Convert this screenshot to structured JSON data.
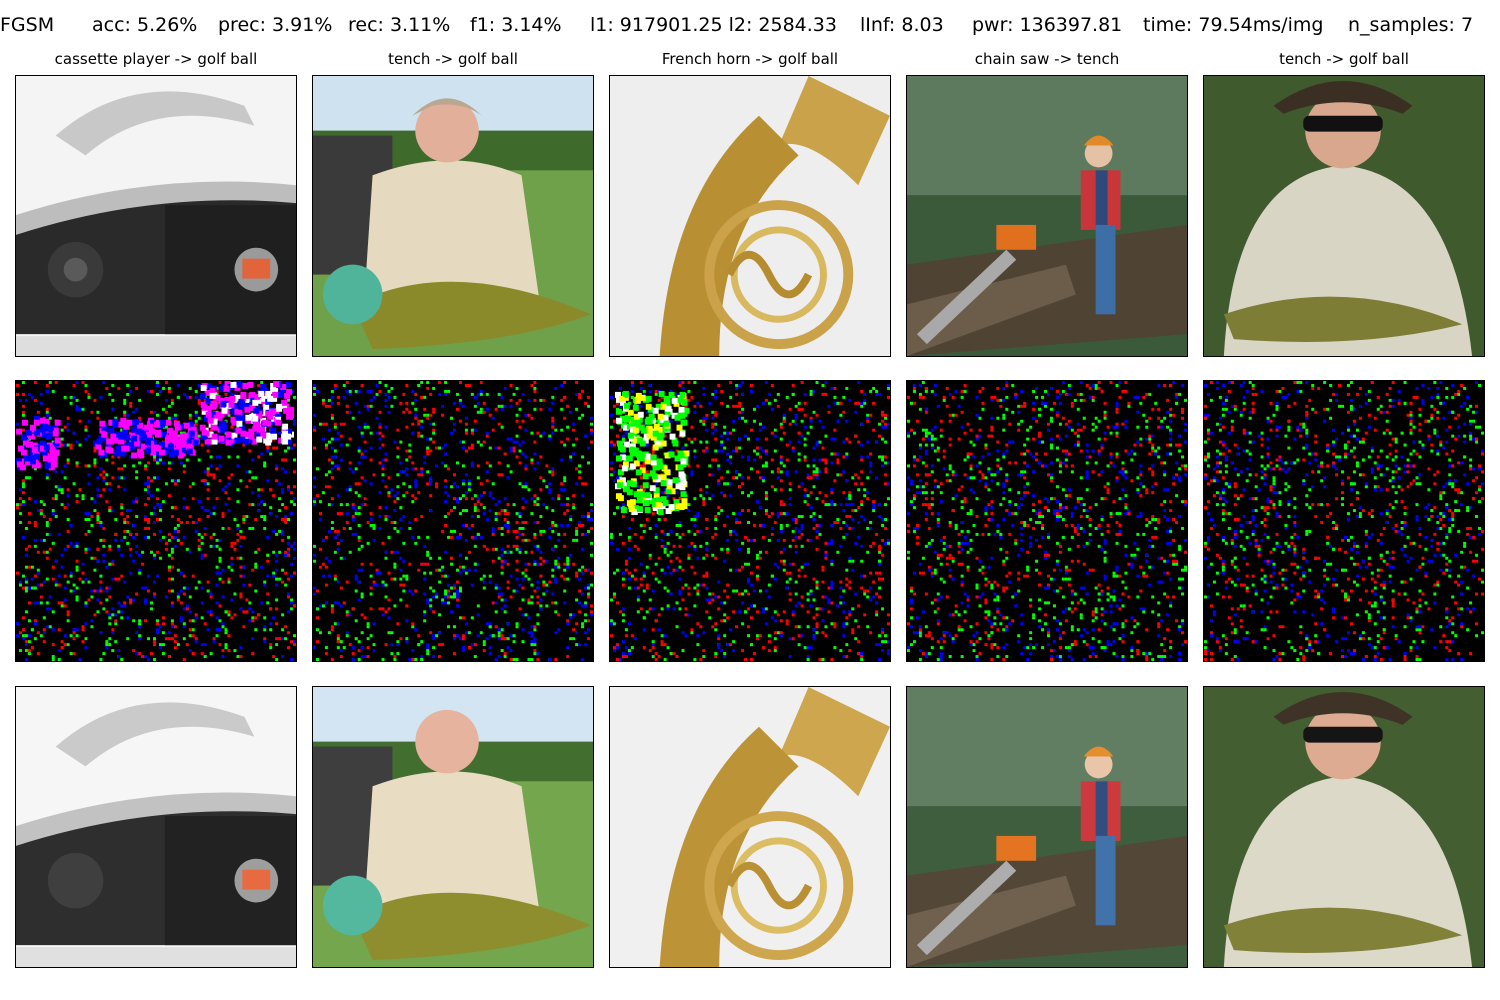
{
  "header": {
    "method": "FGSM",
    "acc": "acc: 5.26%",
    "prec": "prec: 3.91%",
    "rec": "rec: 3.11%",
    "f1": "f1: 3.14%",
    "l1l2": "l1: 917901.25 l2: 2584.33",
    "linf": "lInf: 8.03",
    "pwr": "pwr: 136397.81",
    "time": "time: 79.54ms/img",
    "n_samples": "n_samples: 7"
  },
  "columns": [
    {
      "title": "cassette player -> golf ball",
      "subject": "boombox-icon"
    },
    {
      "title": "tench -> golf ball",
      "subject": "woman-with-fish-icon"
    },
    {
      "title": "French horn -> golf ball",
      "subject": "french-horn-icon"
    },
    {
      "title": "chain saw -> tench",
      "subject": "lumberjack-icon"
    },
    {
      "title": "tench -> golf ball",
      "subject": "man-with-fish-icon"
    }
  ],
  "rows": [
    "original",
    "perturbation",
    "adversarial"
  ],
  "colors": {
    "noise": [
      "#ff0000",
      "#00ff00",
      "#0000ff",
      "#ff00ff",
      "#ffffff",
      "#00ffff",
      "#ffff00"
    ]
  }
}
